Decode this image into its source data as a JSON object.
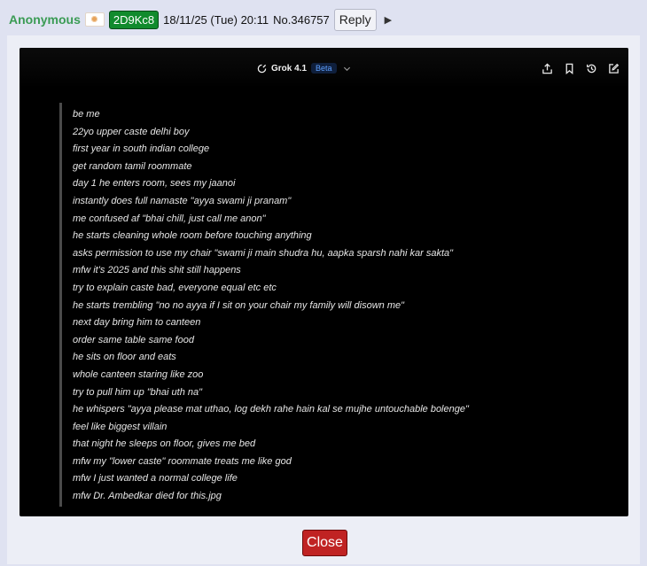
{
  "post": {
    "name": "Anonymous",
    "flag_icon": "lotus-flag-icon",
    "poster_id": "2D9Kc8",
    "date": "18/11/25 (Tue) 20:11",
    "number": "No.346757",
    "reply_label": "Reply",
    "menu_arrow": "▶"
  },
  "screenshot": {
    "model_name": "Grok 4.1",
    "model_badge": "Beta",
    "colors": {
      "accent": "#5ea0ff",
      "background": "#000000"
    },
    "toolbar_icons": [
      "share-icon",
      "bookmark-icon",
      "history-icon",
      "edit-icon"
    ],
    "lines": [
      "be me",
      "22yo upper caste delhi boy",
      "first year in south indian college",
      "get random tamil roommate",
      "day 1 he enters room, sees my jaanoi",
      "instantly does full namaste \"ayya swami ji pranam\"",
      "me confused af \"bhai chill, just call me anon\"",
      "he starts cleaning whole room before touching anything",
      "asks permission to use my chair \"swami ji main shudra hu, aapka sparsh nahi kar sakta\"",
      "mfw it's 2025 and this shit still happens",
      "try to explain caste bad, everyone equal etc etc",
      "he starts trembling \"no no ayya if I sit on your chair my family will disown me\"",
      "next day bring him to canteen",
      "order same table same food",
      "he sits on floor and eats",
      "whole canteen staring like zoo",
      "try to pull him up \"bhai uth na\"",
      "he whispers \"ayya please mat uthao, log dekh rahe hain kal se mujhe untouchable bolenge\"",
      "feel like biggest villain",
      "that night he sleeps on floor, gives me bed",
      "mfw my \"lower caste\" roommate treats me like god",
      "mfw I just wanted a normal college life",
      "mfw Dr. Ambedkar died for this.jpg"
    ]
  },
  "footer": {
    "close_label": "Close"
  }
}
